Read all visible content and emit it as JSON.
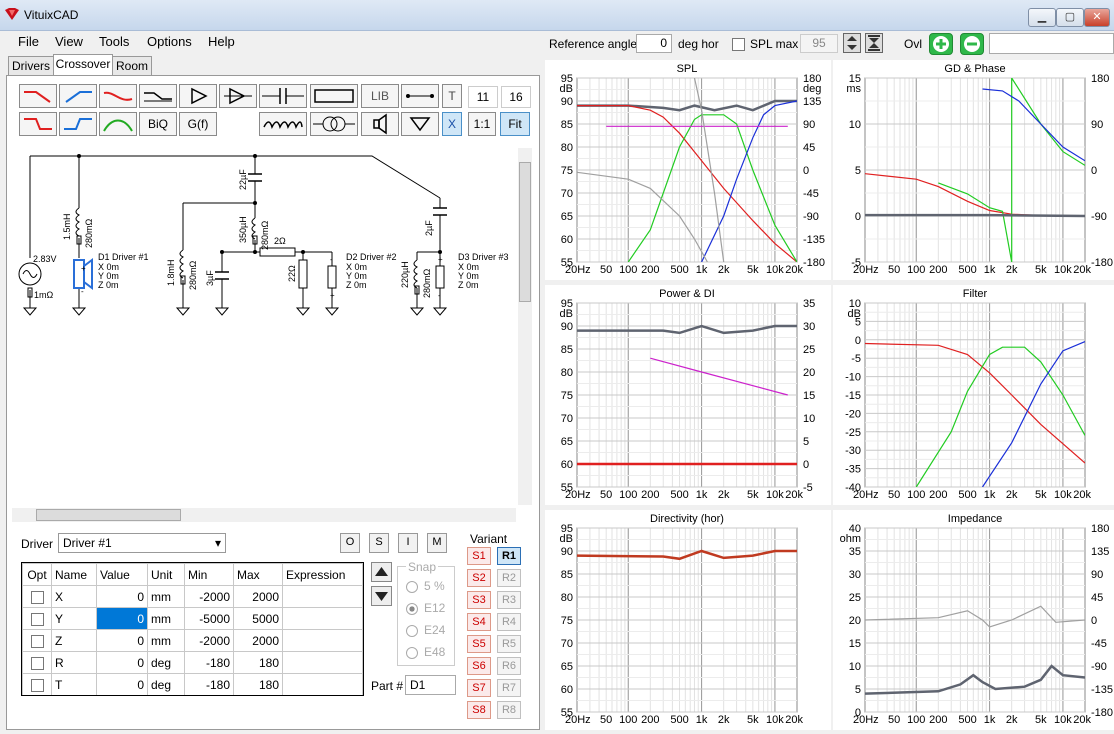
{
  "window": {
    "title": "VituixCAD"
  },
  "menu": [
    "File",
    "View",
    "Tools",
    "Options",
    "Help"
  ],
  "tabs": [
    "Drivers",
    "Crossover",
    "Room"
  ],
  "toolbar": {
    "lib": "LIB",
    "t": "T",
    "biq": "BiQ",
    "gf": "G(f)",
    "x": "X",
    "one_one": "1:1",
    "fit": "Fit",
    "num1": "11",
    "num2": "16"
  },
  "top_controls": {
    "ref_angle_label": "Reference angle",
    "ref_angle_value": "0",
    "deg_hor": "deg hor",
    "spl_max_label": "SPL max",
    "spl_max_value": "95",
    "ovl": "Ovl"
  },
  "schematic": {
    "source": "2.83V",
    "source_r": "1mΩ",
    "d1": [
      "D1 Driver #1",
      "X 0m",
      "Y 0m",
      "Z 0m"
    ],
    "d2": [
      "D2 Driver #2",
      "X 0m",
      "Y 0m",
      "Z 0m"
    ],
    "d3": [
      "D3 Driver #3",
      "X 0m",
      "Y 0m",
      "Z 0m"
    ],
    "c_22": "22µF",
    "l_15": "1.5mH",
    "r_280a": "280mΩ",
    "l_350": "350µH",
    "r_280b": "280mΩ",
    "r_2": "2Ω",
    "c_2": "2µF",
    "l_18": "1.8mH",
    "r_280c": "280mΩ",
    "c_3": "3µF",
    "r_22": "22Ω",
    "l_220": "220µH",
    "r_280d": "280mΩ"
  },
  "driver_sel": {
    "label": "Driver",
    "value": "Driver #1",
    "btns": [
      "O",
      "S",
      "I",
      "M"
    ]
  },
  "params": {
    "headers": [
      "Opt",
      "Name",
      "Value",
      "Unit",
      "Min",
      "Max",
      "Expression"
    ],
    "rows": [
      {
        "name": "X",
        "value": "0",
        "unit": "mm",
        "min": "-2000",
        "max": "2000"
      },
      {
        "name": "Y",
        "value": "0",
        "unit": "mm",
        "min": "-5000",
        "max": "5000"
      },
      {
        "name": "Z",
        "value": "0",
        "unit": "mm",
        "min": "-2000",
        "max": "2000"
      },
      {
        "name": "R",
        "value": "0",
        "unit": "deg",
        "min": "-180",
        "max": "180"
      },
      {
        "name": "T",
        "value": "0",
        "unit": "deg",
        "min": "-180",
        "max": "180"
      }
    ]
  },
  "snap": {
    "label": "Snap",
    "options": [
      "5 %",
      "E12",
      "E24",
      "E48"
    ],
    "selected": "E12"
  },
  "part": {
    "label": "Part #",
    "value": "D1"
  },
  "variant": {
    "label": "Variant",
    "s": [
      "S1",
      "S2",
      "S3",
      "S4",
      "S5",
      "S6",
      "S7",
      "S8"
    ],
    "r": [
      "R1",
      "R2",
      "R3",
      "R4",
      "R5",
      "R6",
      "R7",
      "R8"
    ],
    "active": "R1"
  },
  "colors": {
    "green": "#22cc22",
    "red": "#e02020",
    "blue": "#1a2fd8",
    "gray": "#5f6470",
    "magenta": "#cc22cc",
    "lightgray": "#a0a0a0"
  },
  "x_ticks": [
    "20Hz",
    "50",
    "100",
    "200",
    "500",
    "1k",
    "2k",
    "5k",
    "10k",
    "20k"
  ],
  "plots": [
    {
      "title": "SPL",
      "unit_left": "dB",
      "unit_right": "deg",
      "left_ticks": [
        "95",
        "90",
        "85",
        "80",
        "75",
        "70",
        "65",
        "60",
        "55"
      ],
      "right_ticks": [
        "180",
        "135",
        "90",
        "45",
        "0",
        "-45",
        "-90",
        "-135",
        "-180"
      ]
    },
    {
      "title": "GD & Phase",
      "unit_left": "ms",
      "unit_right": "",
      "left_ticks": [
        "15",
        "10",
        "5",
        "0",
        "-5"
      ],
      "right_ticks": [
        "180",
        "90",
        "0",
        "-90",
        "-180"
      ]
    },
    {
      "title": "Power & DI",
      "unit_left": "dB",
      "unit_right": "",
      "left_ticks": [
        "95",
        "90",
        "85",
        "80",
        "75",
        "70",
        "65",
        "60",
        "55"
      ],
      "right_ticks": [
        "35",
        "30",
        "25",
        "20",
        "15",
        "10",
        "5",
        "0",
        "-5"
      ]
    },
    {
      "title": "Filter",
      "unit_left": "dB",
      "unit_right": "",
      "left_ticks": [
        "10",
        "5",
        "0",
        "-5",
        "-10",
        "-15",
        "-20",
        "-25",
        "-30",
        "-35",
        "-40"
      ],
      "right_ticks": []
    },
    {
      "title": "Directivity (hor)",
      "unit_left": "dB",
      "unit_right": "",
      "left_ticks": [
        "95",
        "90",
        "85",
        "80",
        "75",
        "70",
        "65",
        "60",
        "55"
      ],
      "right_ticks": []
    },
    {
      "title": "Impedance",
      "unit_left": "ohm",
      "unit_right": "",
      "left_ticks": [
        "40",
        "35",
        "30",
        "25",
        "20",
        "15",
        "10",
        "5",
        "0"
      ],
      "right_ticks": [
        "180",
        "135",
        "90",
        "45",
        "0",
        "-45",
        "-90",
        "-135",
        "-180"
      ]
    }
  ],
  "chart_data": [
    {
      "type": "line",
      "title": "SPL",
      "x_scale": "log",
      "xlim": [
        20,
        20000
      ],
      "ylim": [
        55,
        95
      ],
      "y2lim": [
        -180,
        180
      ],
      "series": [
        {
          "color": "#5f6470",
          "points": [
            [
              20,
              89
            ],
            [
              100,
              89
            ],
            [
              300,
              88.5
            ],
            [
              500,
              88
            ],
            [
              800,
              89
            ],
            [
              1500,
              88
            ],
            [
              3000,
              89
            ],
            [
              5000,
              88
            ],
            [
              10000,
              90
            ],
            [
              20000,
              90
            ]
          ]
        },
        {
          "color": "#e02020",
          "points": [
            [
              20,
              89
            ],
            [
              100,
              89
            ],
            [
              200,
              88
            ],
            [
              300,
              86.5
            ],
            [
              500,
              83
            ],
            [
              1000,
              77
            ],
            [
              2000,
              71
            ],
            [
              5000,
              64
            ],
            [
              10000,
              59
            ],
            [
              20000,
              55
            ]
          ]
        },
        {
          "color": "#22cc22",
          "points": [
            [
              100,
              55
            ],
            [
              200,
              62
            ],
            [
              500,
              80
            ],
            [
              800,
              86
            ],
            [
              1000,
              87
            ],
            [
              2000,
              87
            ],
            [
              3000,
              85
            ],
            [
              5000,
              75
            ],
            [
              10000,
              63
            ],
            [
              20000,
              55
            ]
          ]
        },
        {
          "color": "#1a2fd8",
          "points": [
            [
              1000,
              55
            ],
            [
              2000,
              65
            ],
            [
              3000,
              73
            ],
            [
              5000,
              82
            ],
            [
              7000,
              87
            ],
            [
              10000,
              89
            ],
            [
              20000,
              90
            ]
          ]
        },
        {
          "color": "#cc22cc",
          "points": [
            [
              50,
              84.5
            ],
            [
              15000,
              84.5
            ]
          ]
        },
        {
          "color": "#a0a0a0",
          "points": [
            [
              20,
              74.5
            ],
            [
              100,
              73
            ],
            [
              200,
              71
            ],
            [
              500,
              65
            ],
            [
              800,
              60
            ],
            [
              1200,
              55
            ]
          ]
        },
        {
          "color": "#a0a0a0",
          "points": [
            [
              800,
              95
            ],
            [
              1000,
              88
            ],
            [
              1500,
              70
            ],
            [
              2000,
              55
            ]
          ]
        }
      ]
    },
    {
      "type": "line",
      "title": "GD & Phase",
      "x_scale": "log",
      "xlim": [
        20,
        20000
      ],
      "ylim": [
        -5,
        15
      ],
      "y2lim": [
        -180,
        180
      ],
      "series": [
        {
          "color": "#e02020",
          "points": [
            [
              20,
              4.6
            ],
            [
              100,
              4
            ],
            [
              200,
              3.2
            ],
            [
              500,
              1.6
            ],
            [
              1000,
              0.6
            ],
            [
              2000,
              0.2
            ],
            [
              5000,
              0.05
            ],
            [
              20000,
              0
            ]
          ]
        },
        {
          "color": "#22cc22",
          "points": [
            [
              200,
              3.6
            ],
            [
              500,
              2.4
            ],
            [
              1000,
              0.9
            ],
            [
              1500,
              0.5
            ],
            [
              2000,
              -5
            ],
            [
              2000,
              15
            ],
            [
              5000,
              10
            ],
            [
              10000,
              7
            ],
            [
              20000,
              5.5
            ]
          ]
        },
        {
          "color": "#1a2fd8",
          "points": [
            [
              800,
              13.8
            ],
            [
              1500,
              13.6
            ],
            [
              2500,
              12.5
            ],
            [
              5000,
              10
            ],
            [
              10000,
              7.5
            ],
            [
              20000,
              6
            ]
          ]
        },
        {
          "color": "#5f6470",
          "points": [
            [
              20,
              0.1
            ],
            [
              1000,
              0.1
            ],
            [
              20000,
              0
            ]
          ]
        }
      ]
    },
    {
      "type": "line",
      "title": "Power & DI",
      "x_scale": "log",
      "xlim": [
        20,
        20000
      ],
      "ylim": [
        55,
        95
      ],
      "y2lim": [
        -5,
        35
      ],
      "series": [
        {
          "color": "#5f6470",
          "points": [
            [
              20,
              89
            ],
            [
              300,
              89
            ],
            [
              500,
              88.5
            ],
            [
              1000,
              90
            ],
            [
              2000,
              88.5
            ],
            [
              5000,
              89
            ],
            [
              10000,
              90
            ],
            [
              20000,
              90
            ]
          ]
        },
        {
          "color": "#cc22cc",
          "points": [
            [
              200,
              83
            ],
            [
              1000,
              80
            ],
            [
              15000,
              75
            ]
          ]
        },
        {
          "color": "#e02020",
          "points": [
            [
              20,
              60
            ],
            [
              20000,
              60
            ]
          ]
        }
      ]
    },
    {
      "type": "line",
      "title": "Filter",
      "x_scale": "log",
      "xlim": [
        20,
        20000
      ],
      "ylim": [
        -40,
        10
      ],
      "series": [
        {
          "color": "#e02020",
          "points": [
            [
              20,
              -1
            ],
            [
              200,
              -1.5
            ],
            [
              500,
              -4
            ],
            [
              1000,
              -9
            ],
            [
              2000,
              -15
            ],
            [
              5000,
              -23
            ],
            [
              20000,
              -33.5
            ]
          ]
        },
        {
          "color": "#22cc22",
          "points": [
            [
              100,
              -40
            ],
            [
              300,
              -25
            ],
            [
              500,
              -14
            ],
            [
              1000,
              -4
            ],
            [
              1500,
              -2
            ],
            [
              3000,
              -2
            ],
            [
              5000,
              -6
            ],
            [
              10000,
              -15
            ],
            [
              20000,
              -26
            ]
          ]
        },
        {
          "color": "#1a2fd8",
          "points": [
            [
              800,
              -40
            ],
            [
              2000,
              -28
            ],
            [
              5000,
              -12
            ],
            [
              10000,
              -3
            ],
            [
              20000,
              -0.5
            ]
          ]
        }
      ]
    },
    {
      "type": "line",
      "title": "Directivity (hor)",
      "x_scale": "log",
      "xlim": [
        20,
        20000
      ],
      "ylim": [
        55,
        95
      ],
      "series": [
        {
          "color": "#c03a20",
          "points": [
            [
              20,
              89
            ],
            [
              300,
              88.8
            ],
            [
              500,
              88.3
            ],
            [
              1000,
              90
            ],
            [
              2000,
              88.5
            ],
            [
              5000,
              89
            ],
            [
              10000,
              90
            ],
            [
              20000,
              90
            ]
          ]
        }
      ]
    },
    {
      "type": "line",
      "title": "Impedance",
      "x_scale": "log",
      "xlim": [
        20,
        20000
      ],
      "ylim": [
        0,
        40
      ],
      "y2lim": [
        -180,
        180
      ],
      "series": [
        {
          "color": "#a0a0a0",
          "points": [
            [
              20,
              20
            ],
            [
              200,
              20.5
            ],
            [
              500,
              22
            ],
            [
              800,
              20
            ],
            [
              1000,
              18.5
            ],
            [
              2000,
              20
            ],
            [
              5000,
              23
            ],
            [
              8000,
              19.5
            ],
            [
              20000,
              20
            ]
          ]
        },
        {
          "color": "#5f6470",
          "points": [
            [
              20,
              4
            ],
            [
              200,
              4.5
            ],
            [
              400,
              6
            ],
            [
              600,
              8
            ],
            [
              800,
              6.5
            ],
            [
              1200,
              5
            ],
            [
              3000,
              5.5
            ],
            [
              5000,
              7
            ],
            [
              7000,
              10
            ],
            [
              10000,
              8
            ],
            [
              20000,
              7.5
            ]
          ]
        }
      ]
    }
  ]
}
